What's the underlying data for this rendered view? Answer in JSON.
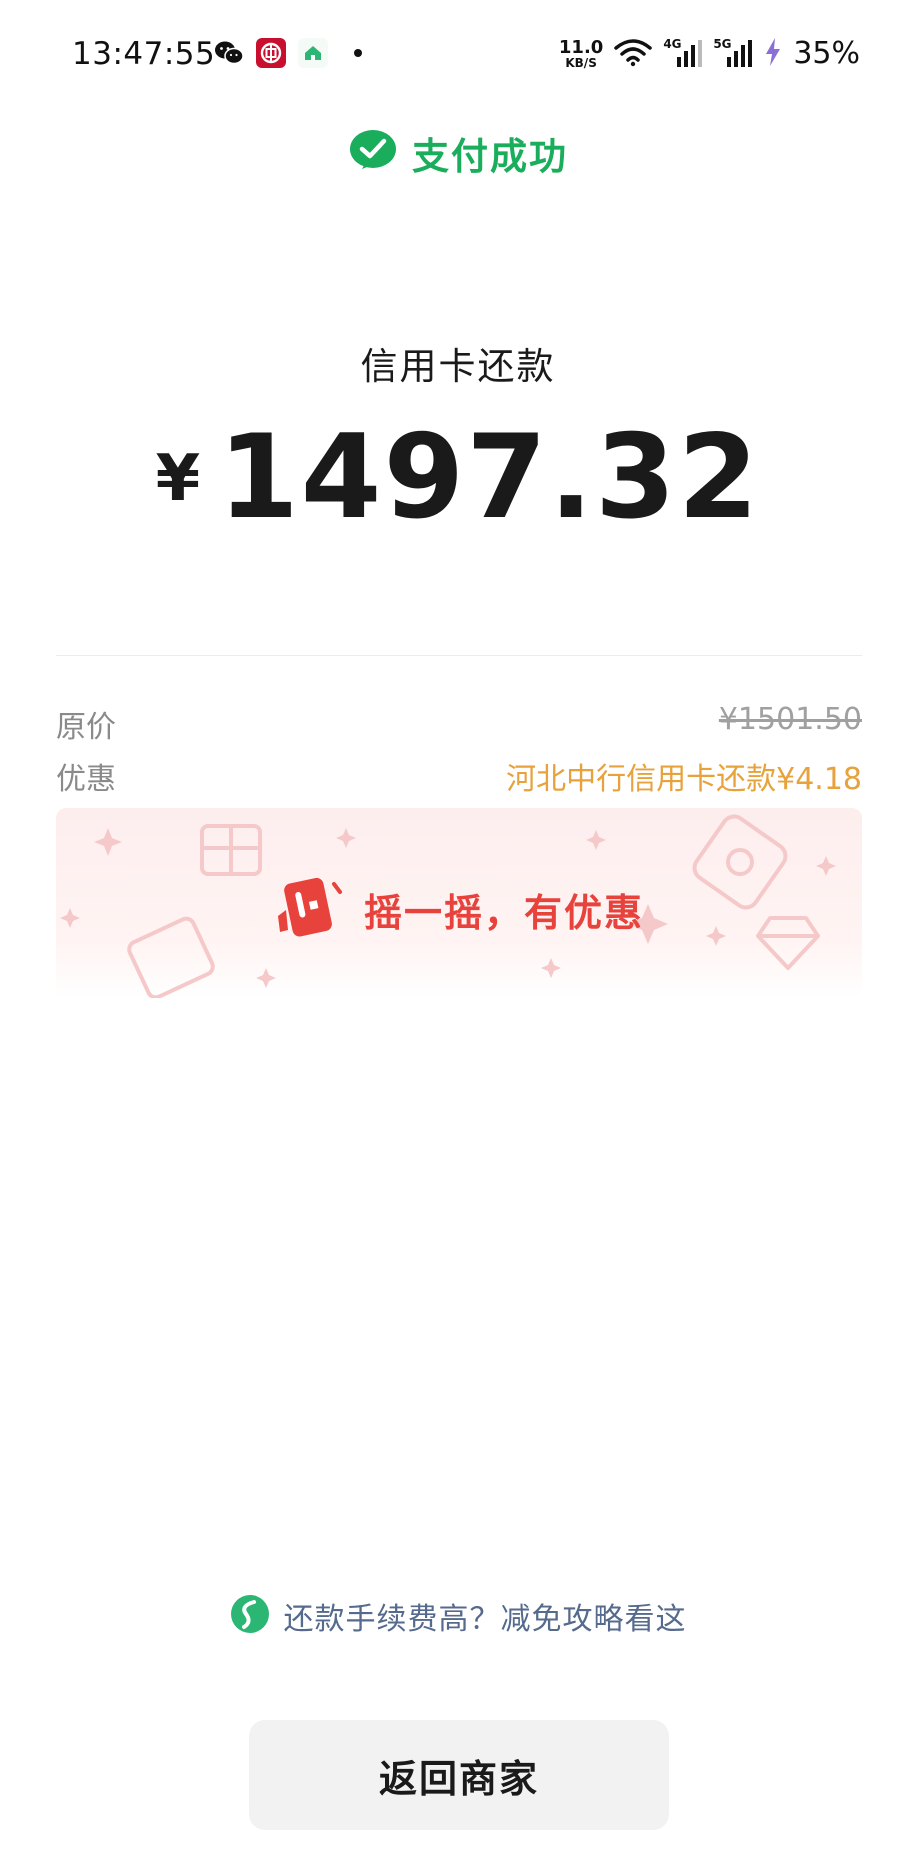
{
  "status_bar": {
    "time": "13:47:55",
    "net_speed_value": "11.0",
    "net_speed_unit": "KB/S",
    "signal_1_label": "4G",
    "signal_2_label": "5G",
    "battery": "35%",
    "notification_icons": [
      "wechat-icon",
      "bank-app-icon",
      "home-app-icon"
    ]
  },
  "header": {
    "success_text": "支付成功",
    "accent_color": "#1aad5b"
  },
  "payment": {
    "payee": "信用卡还款",
    "currency": "¥",
    "amount": "1497.32"
  },
  "details": {
    "original_label": "原价",
    "original_value": "¥1501.50",
    "discount_label": "优惠",
    "discount_value": "河北中行信用卡还款¥4.18",
    "discount_color": "#e7a23c"
  },
  "banner": {
    "text": "摇一摇，有优惠",
    "color": "#e8423c"
  },
  "tip": {
    "text": "还款手续费高？减免攻略看这"
  },
  "footer": {
    "return_label": "返回商家"
  }
}
